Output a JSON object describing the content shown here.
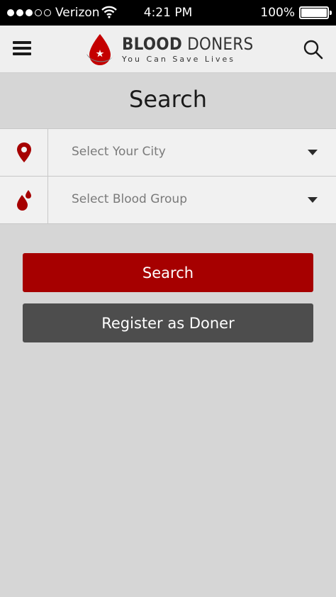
{
  "status_bar": {
    "carrier": "Verizon",
    "time": "4:21 PM",
    "battery": "100%"
  },
  "header": {
    "brand_bold": "BLOOD",
    "brand_light": "DONERS",
    "tagline": "You Can Save Lives",
    "menu_icon": "hamburger-menu-icon",
    "search_icon": "search-icon"
  },
  "page": {
    "title": "Search"
  },
  "form": {
    "city_placeholder": "Select Your City",
    "blood_group_placeholder": "Select Blood Group",
    "city_icon": "location-pin-icon",
    "blood_icon": "blood-drops-icon"
  },
  "actions": {
    "search_label": "Search",
    "register_label": "Register as Doner"
  },
  "colors": {
    "accent": "#a60000",
    "secondary_button": "#4d4d4d",
    "background": "#d6d6d6",
    "header_bg": "#efefef",
    "field_bg": "#f1f1f1"
  }
}
